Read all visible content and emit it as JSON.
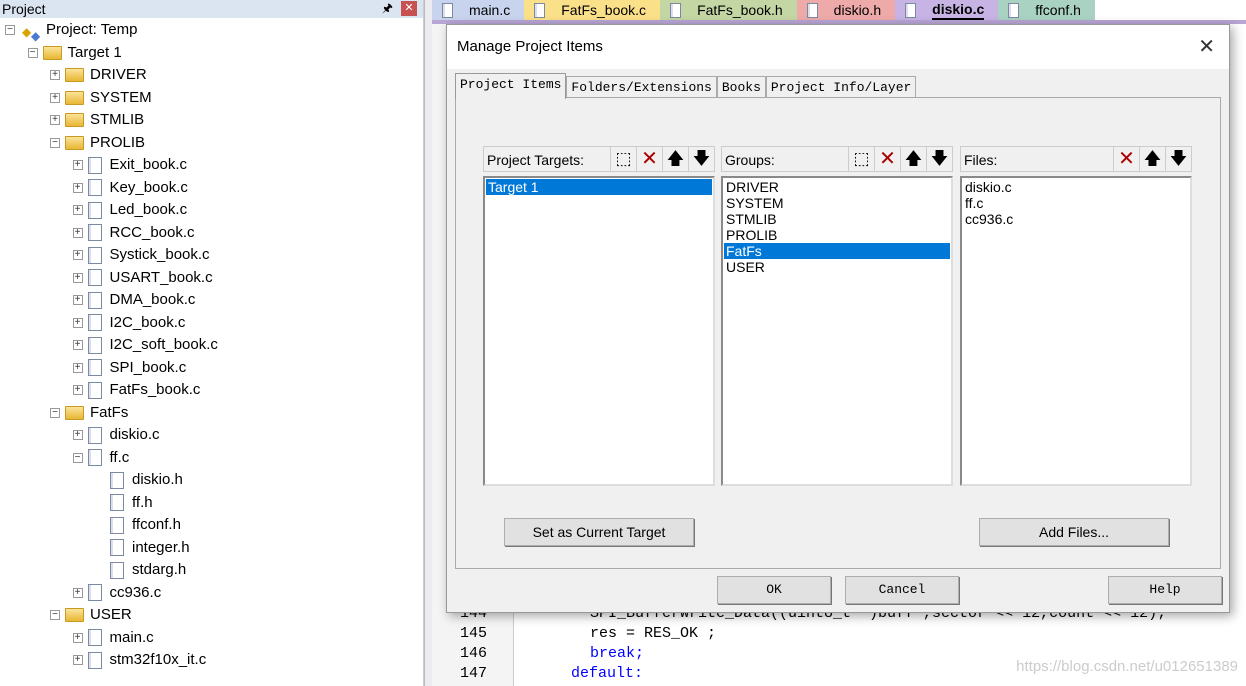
{
  "project_panel": {
    "title": "Project",
    "pin_icon": "pin-icon",
    "close_icon": "close-icon",
    "tree": [
      {
        "label": "Project: Temp",
        "level": 0,
        "toggle": "minus",
        "icon": "project"
      },
      {
        "label": "Target 1",
        "level": 1,
        "toggle": "minus",
        "icon": "target-folder"
      },
      {
        "label": "DRIVER",
        "level": 2,
        "toggle": "plus",
        "icon": "folder"
      },
      {
        "label": "SYSTEM",
        "level": 2,
        "toggle": "plus",
        "icon": "folder"
      },
      {
        "label": "STMLIB",
        "level": 2,
        "toggle": "plus",
        "icon": "folder"
      },
      {
        "label": "PROLIB",
        "level": 2,
        "toggle": "minus",
        "icon": "folder"
      },
      {
        "label": "Exit_book.c",
        "level": 3,
        "toggle": "plus",
        "icon": "file"
      },
      {
        "label": "Key_book.c",
        "level": 3,
        "toggle": "plus",
        "icon": "file"
      },
      {
        "label": "Led_book.c",
        "level": 3,
        "toggle": "plus",
        "icon": "file"
      },
      {
        "label": "RCC_book.c",
        "level": 3,
        "toggle": "plus",
        "icon": "file"
      },
      {
        "label": "Systick_book.c",
        "level": 3,
        "toggle": "plus",
        "icon": "file"
      },
      {
        "label": "USART_book.c",
        "level": 3,
        "toggle": "plus",
        "icon": "file"
      },
      {
        "label": "DMA_book.c",
        "level": 3,
        "toggle": "plus",
        "icon": "file"
      },
      {
        "label": "I2C_book.c",
        "level": 3,
        "toggle": "plus",
        "icon": "file"
      },
      {
        "label": "I2C_soft_book.c",
        "level": 3,
        "toggle": "plus",
        "icon": "file"
      },
      {
        "label": "SPI_book.c",
        "level": 3,
        "toggle": "plus",
        "icon": "file"
      },
      {
        "label": "FatFs_book.c",
        "level": 3,
        "toggle": "plus",
        "icon": "file"
      },
      {
        "label": "FatFs",
        "level": 2,
        "toggle": "minus",
        "icon": "folder"
      },
      {
        "label": "diskio.c",
        "level": 3,
        "toggle": "plus",
        "icon": "file"
      },
      {
        "label": "ff.c",
        "level": 3,
        "toggle": "minus",
        "icon": "file"
      },
      {
        "label": "diskio.h",
        "level": 4,
        "toggle": "none",
        "icon": "file"
      },
      {
        "label": "ff.h",
        "level": 4,
        "toggle": "none",
        "icon": "file"
      },
      {
        "label": "ffconf.h",
        "level": 4,
        "toggle": "none",
        "icon": "file"
      },
      {
        "label": "integer.h",
        "level": 4,
        "toggle": "none",
        "icon": "file"
      },
      {
        "label": "stdarg.h",
        "level": 4,
        "toggle": "none",
        "icon": "file"
      },
      {
        "label": "cc936.c",
        "level": 3,
        "toggle": "plus",
        "icon": "file"
      },
      {
        "label": "USER",
        "level": 2,
        "toggle": "minus",
        "icon": "folder"
      },
      {
        "label": "main.c",
        "level": 3,
        "toggle": "plus",
        "icon": "file"
      },
      {
        "label": "stm32f10x_it.c",
        "level": 3,
        "toggle": "plus",
        "icon": "file"
      }
    ]
  },
  "editor_tabs": [
    {
      "label": "main.c",
      "color": "#c8d4ee",
      "active": false
    },
    {
      "label": "FatFs_book.c",
      "color": "#fbe08a",
      "active": false
    },
    {
      "label": "FatFs_book.h",
      "color": "#c4d6a4",
      "active": false
    },
    {
      "label": "diskio.h",
      "color": "#eea9a9",
      "active": false
    },
    {
      "label": "diskio.c",
      "color": "#c7b3e4",
      "active": true
    },
    {
      "label": "ffconf.h",
      "color": "#a9d2c2",
      "active": false
    }
  ],
  "code": {
    "lines": [
      {
        "num": "144",
        "text": "SPI_BufferWrite_Data((uint8_t *)buff ,sector << 12,count << 12);"
      },
      {
        "num": "145",
        "text": "res = RES_OK ;"
      },
      {
        "num": "146",
        "text": "break;"
      },
      {
        "num": "147",
        "text": "default:"
      }
    ]
  },
  "watermark": "https://blog.csdn.net/u012651389",
  "dialog": {
    "title": "Manage Project Items",
    "close_icon": "close-icon",
    "tabs": [
      "Project Items",
      "Folders/Extensions",
      "Books",
      "Project Info/Layer"
    ],
    "active_tab": 0,
    "targets": {
      "label": "Project Targets:",
      "items": [
        "Target 1"
      ],
      "selected": 0
    },
    "groups": {
      "label": "Groups:",
      "items": [
        "DRIVER",
        "SYSTEM",
        "STMLIB",
        "PROLIB",
        "FatFs",
        "USER"
      ],
      "selected": 4
    },
    "files": {
      "label": "Files:",
      "items": [
        "diskio.c",
        "ff.c",
        "cc936.c"
      ],
      "selected": -1
    },
    "set_current_target": "Set as Current Target",
    "add_files": "Add Files...",
    "ok": "OK",
    "cancel": "Cancel",
    "help": "Help"
  }
}
